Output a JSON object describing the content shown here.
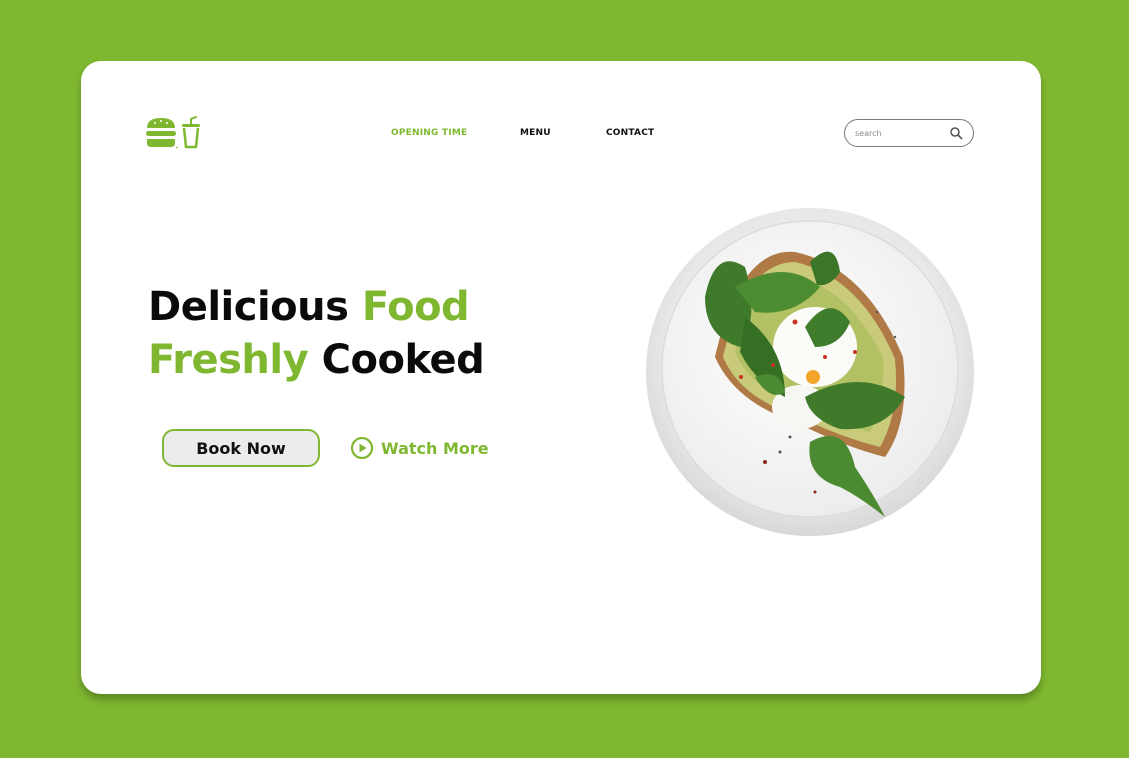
{
  "nav": {
    "items": [
      {
        "label": "OPENING TIME",
        "active": true
      },
      {
        "label": "MENU",
        "active": false
      },
      {
        "label": "CONTACT",
        "active": false
      }
    ]
  },
  "search": {
    "placeholder": "search",
    "value": ""
  },
  "hero": {
    "line1_part1": "Delicious",
    "line1_part2": "Food",
    "line2_part1": "Freshly",
    "line2_part2": "Cooked",
    "book_label": "Book Now",
    "watch_label": "Watch More"
  },
  "icons": {
    "logo": "burger-and-drink-icon",
    "search": "search-icon",
    "play": "play-circle-icon",
    "image": "food-plate-image"
  },
  "colors": {
    "accent": "#7fb830",
    "text": "#0a0a0a",
    "background": "#ffffff"
  }
}
